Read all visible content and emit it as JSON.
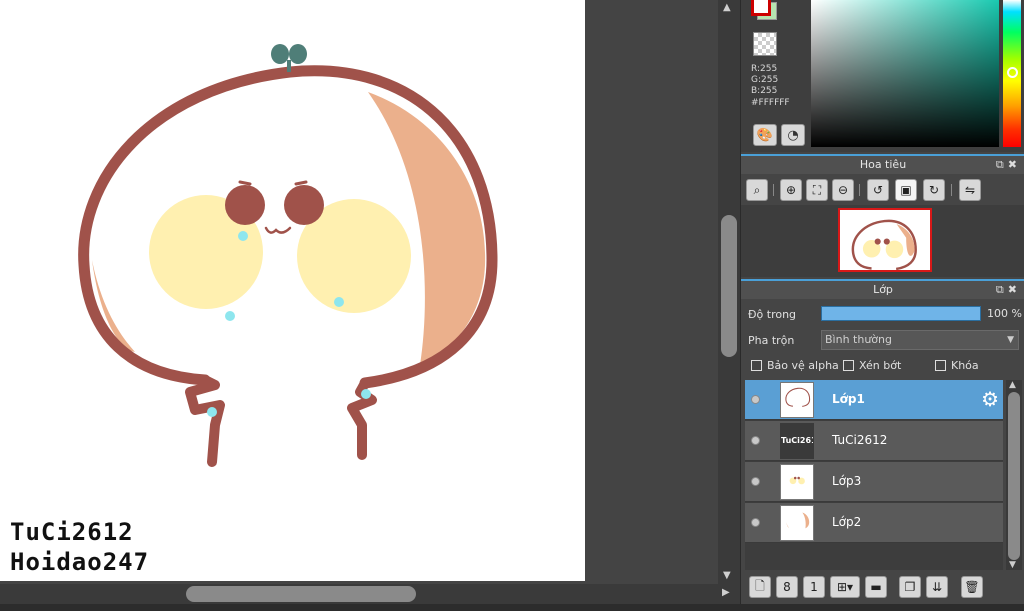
{
  "canvas": {
    "signature_line1": "TuCi2612",
    "signature_line2": "Hoidao247"
  },
  "color_panel": {
    "r": "R:255",
    "g": "G:255",
    "b": "B:255",
    "hex": "#FFFFFF",
    "foreground_color": "#FFFFFF",
    "hue_color": "#19C9B0",
    "buttons": [
      "palette-icon",
      "color-history-icon"
    ]
  },
  "navigator": {
    "title": "Hoa tiêu",
    "tools": [
      "zoom-actual-icon",
      "zoom-in-icon",
      "fit-screen-icon",
      "zoom-out-icon",
      "rotate-left-icon",
      "reset-view-icon",
      "rotate-right-icon",
      "flip-horizontal-icon"
    ]
  },
  "layers_panel": {
    "title": "Lớp",
    "opacity_label": "Độ trong",
    "opacity_value": "100 %",
    "opacity_fraction": 1.0,
    "blend_label": "Pha trộn",
    "blend_value": "Bình thường",
    "protect_alpha_label": "Bảo vệ alpha",
    "clipping_label": "Xén bớt",
    "lock_label": "Khóa",
    "layers": [
      {
        "name": "Lớp1",
        "active": true
      },
      {
        "name": "TuCi2612",
        "active": false
      },
      {
        "name": "Lớp3",
        "active": false
      },
      {
        "name": "Lớp2",
        "active": false
      }
    ],
    "toolbar": [
      "new-layer-icon",
      "new-layer-8bit-icon",
      "new-layer-1bit-icon",
      "add-layer-menu-icon",
      "new-folder-icon",
      "duplicate-layer-icon",
      "merge-down-icon",
      "delete-layer-icon"
    ]
  },
  "art_colors": {
    "outline": "#A0524A",
    "shade": "#EBB08C",
    "cheek": "#FFF0B0",
    "sparkle": "#8EE6EE",
    "sprout": "#4F7E78",
    "eyes": "#A0524A"
  }
}
